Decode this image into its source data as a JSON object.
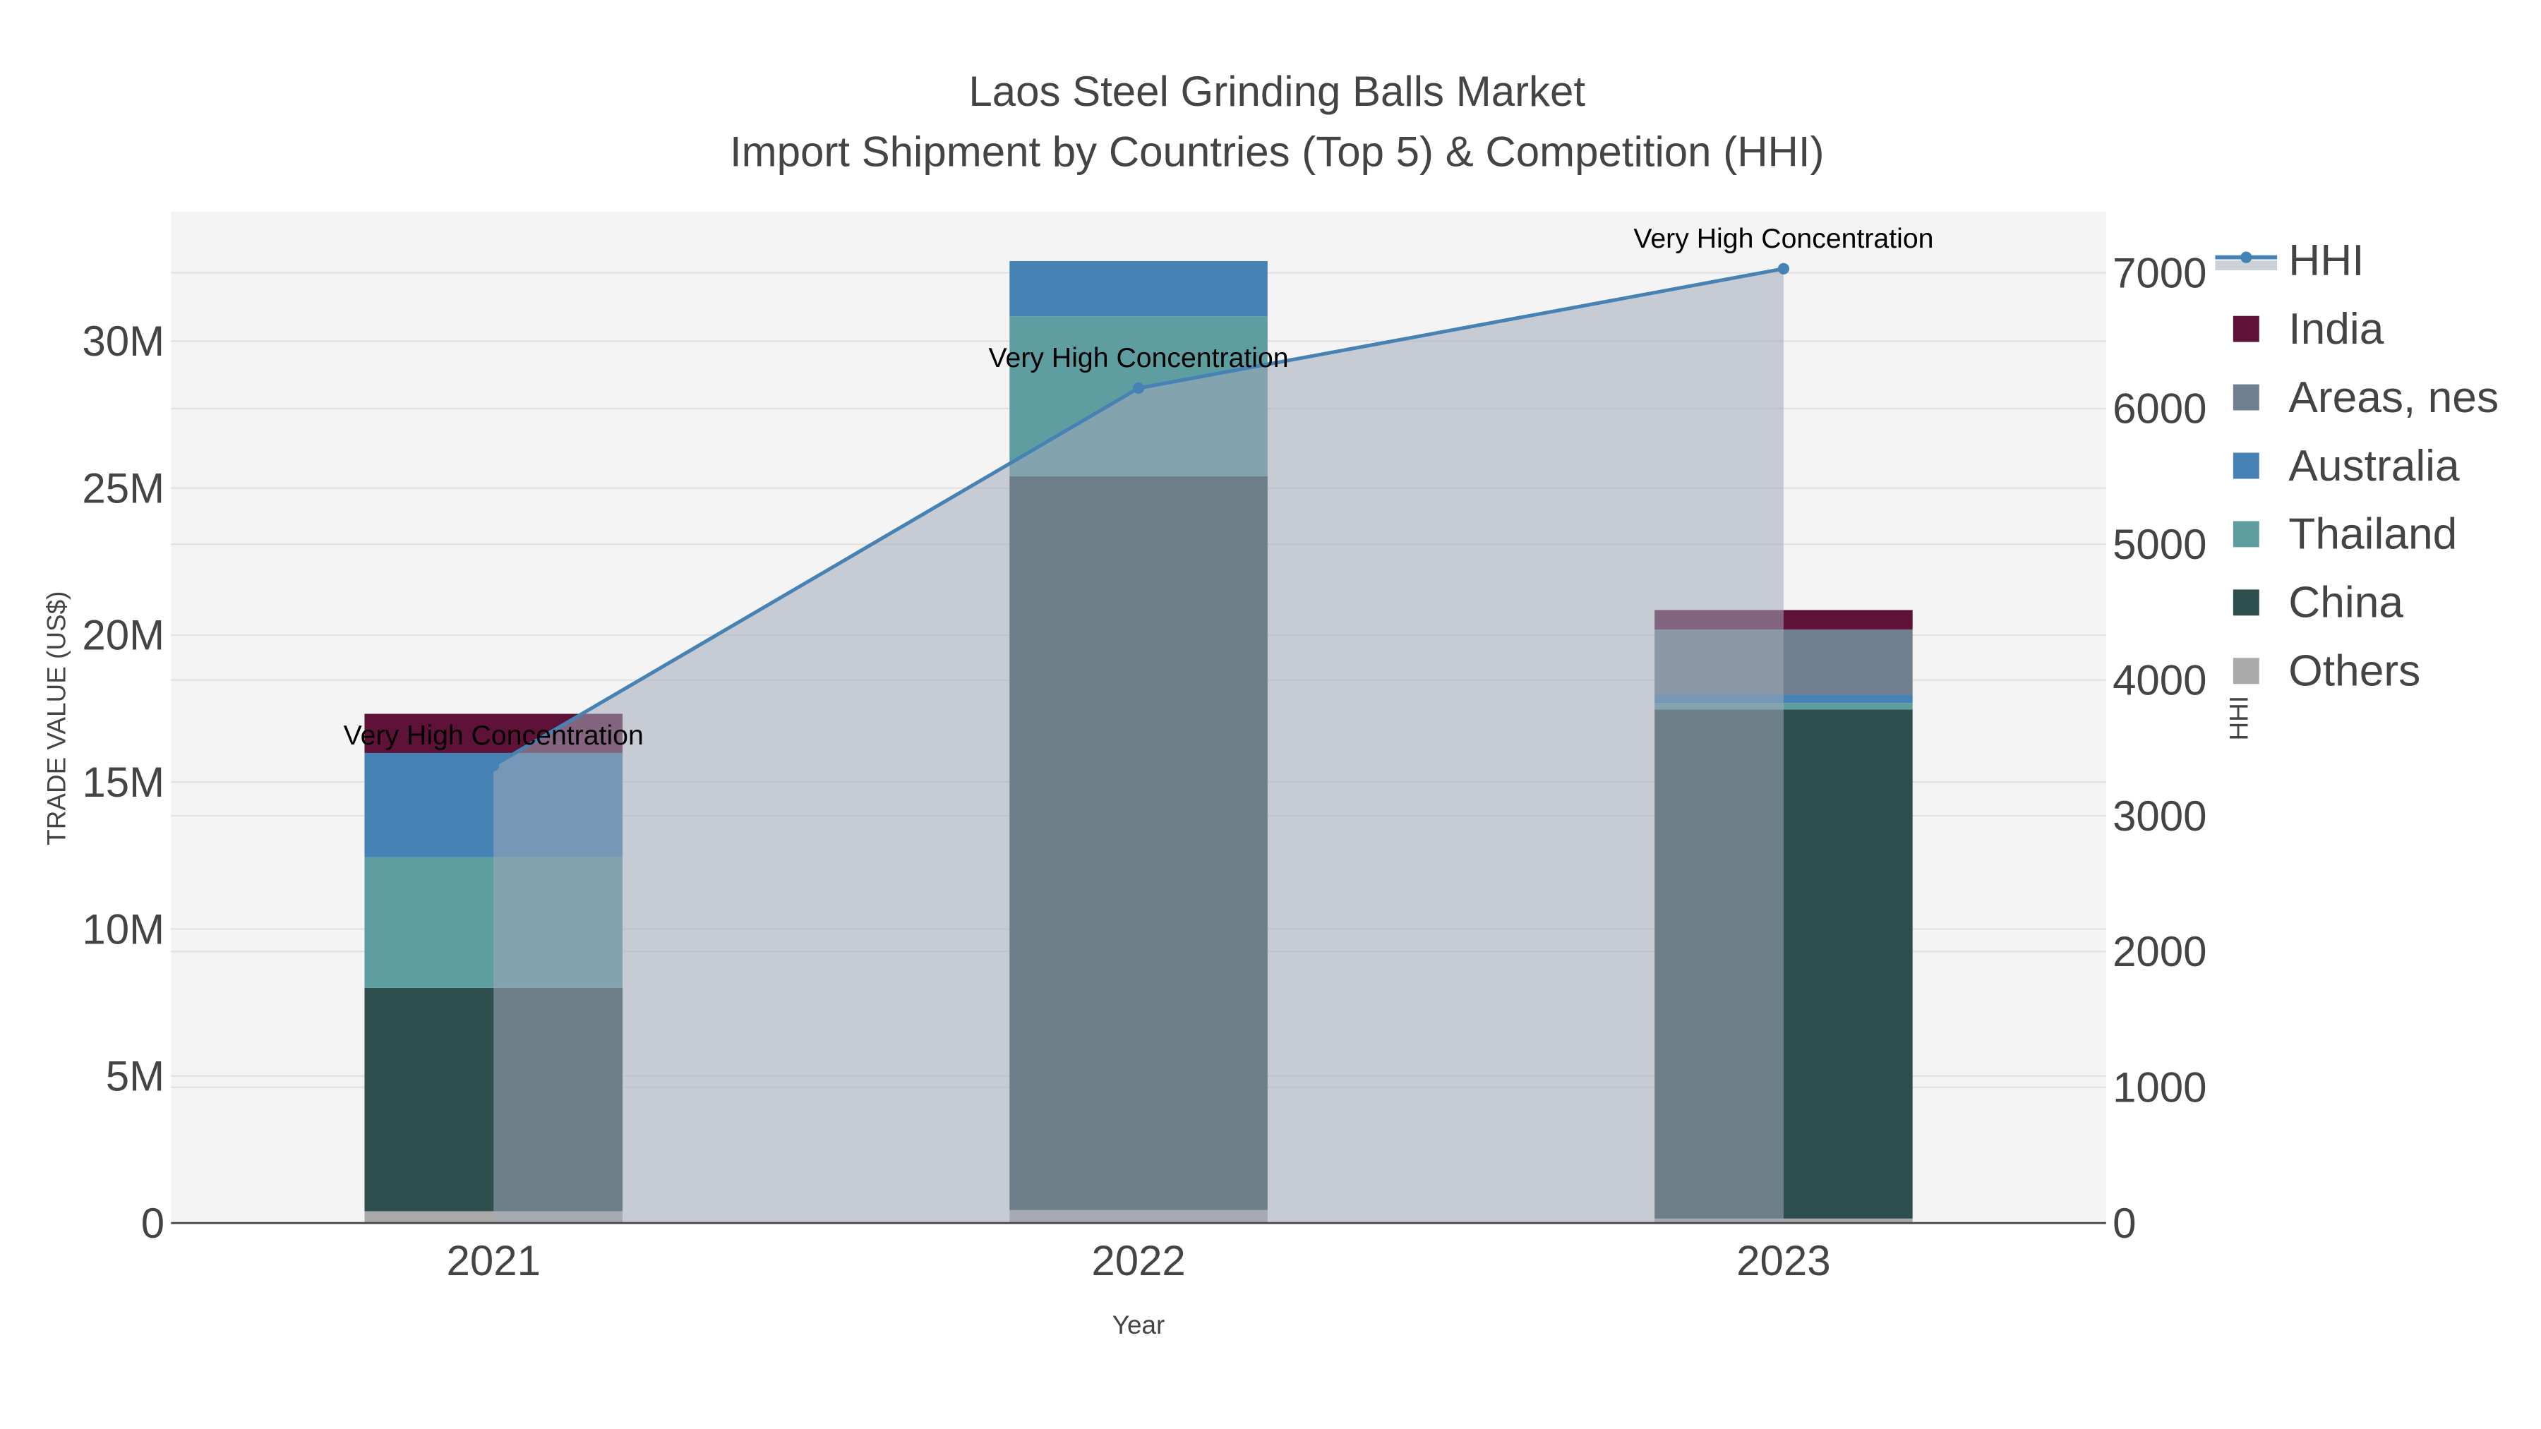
{
  "chart_data": {
    "type": "bar",
    "stacked": true,
    "title": "Laos Steel Grinding Balls Market",
    "subtitle": "Import Shipment by Countries (Top 5) & Competition (HHI)",
    "xlabel": "Year",
    "ylabel": "TRADE VALUE (US$)",
    "y2label": "HHI",
    "categories": [
      "2021",
      "2022",
      "2023"
    ],
    "ylim": [
      0,
      34400000
    ],
    "y2lim": [
      0,
      7450
    ],
    "yticks": [
      0,
      5000000,
      10000000,
      15000000,
      20000000,
      25000000,
      30000000
    ],
    "ytick_labels": [
      "0",
      "5M",
      "10M",
      "15M",
      "20M",
      "25M",
      "30M"
    ],
    "y2ticks": [
      0,
      1000,
      2000,
      3000,
      4000,
      5000,
      6000,
      7000
    ],
    "y2tick_labels": [
      "0",
      "1000",
      "2000",
      "3000",
      "4000",
      "5000",
      "6000",
      "7000"
    ],
    "grid": true,
    "legend_placement": "right",
    "series": [
      {
        "name": "Others",
        "color": "#aaaaaa",
        "values": [
          400000,
          440000,
          150000
        ]
      },
      {
        "name": "China",
        "color": "#2f4f4f",
        "values": [
          7600000,
          24960000,
          17320000
        ]
      },
      {
        "name": "Thailand",
        "color": "#5f9ea0",
        "values": [
          4440000,
          5440000,
          220000
        ]
      },
      {
        "name": "Australia",
        "color": "#4682b4",
        "values": [
          3550000,
          1880000,
          280000
        ]
      },
      {
        "name": "Areas, nes",
        "color": "#708090",
        "values": [
          0,
          0,
          2220000
        ]
      },
      {
        "name": "India",
        "color": "#5f1238",
        "values": [
          1330000,
          0,
          660000
        ]
      }
    ],
    "hhi": {
      "name": "HHI",
      "color": "#4682b4",
      "fill": "rgba(160,170,185,0.55)",
      "values": [
        3370,
        6150,
        7030
      ],
      "annotations": [
        "Very High Concentration",
        "Very High Concentration",
        "Very High Concentration"
      ]
    },
    "legend_order": [
      "HHI",
      "India",
      "Areas, nes",
      "Australia",
      "Thailand",
      "China",
      "Others"
    ]
  }
}
